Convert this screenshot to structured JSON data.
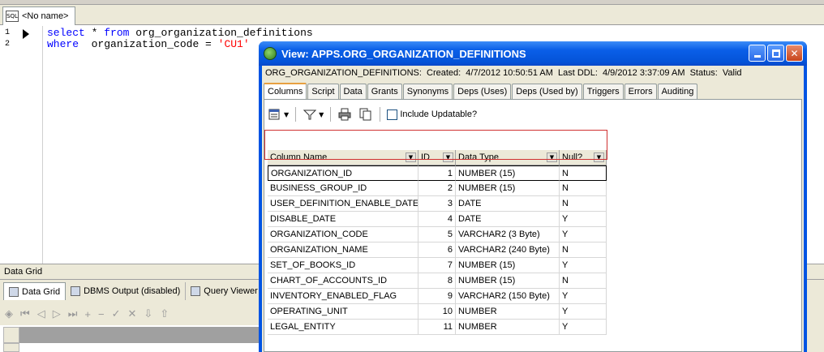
{
  "document_tab": {
    "label": "<No name>",
    "icon": "sql-file-icon"
  },
  "editor": {
    "line_numbers": [
      "1",
      "2"
    ],
    "line1": {
      "kw1": "select",
      "rest": " * ",
      "kw2": "from",
      "table": " org_organization_definitions"
    },
    "line2": {
      "kw": "where",
      "rest": "  organization_code = ",
      "str": "'CU1'"
    }
  },
  "bottom_panel": {
    "title": "Data Grid",
    "tabs": [
      {
        "label": "Data Grid",
        "icon": "grid-icon"
      },
      {
        "label": "DBMS Output (disabled)",
        "icon": "dbms-output-icon"
      },
      {
        "label": "Query Viewer",
        "icon": "query-viewer-icon"
      }
    ]
  },
  "window": {
    "title": "View:  APPS.ORG_ORGANIZATION_DEFINITIONS",
    "info": {
      "object": "ORG_ORGANIZATION_DEFINITIONS:",
      "created_label": "Created:",
      "created": "4/7/2012 10:50:51 AM",
      "ddl_label": "Last DDL:",
      "ddl": "4/9/2012 3:37:09 AM",
      "status_label": "Status:",
      "status": "Valid"
    },
    "tabs": [
      "Columns",
      "Script",
      "Data",
      "Grants",
      "Synonyms",
      "Deps (Uses)",
      "Deps (Used by)",
      "Triggers",
      "Errors",
      "Auditing"
    ],
    "toolbar": {
      "include_updatable": "Include Updatable?"
    },
    "grid": {
      "headers": [
        "Column Name",
        "ID",
        "Data Type",
        "Null?"
      ],
      "rows": [
        [
          "ORGANIZATION_ID",
          "1",
          "NUMBER (15)",
          "N"
        ],
        [
          "BUSINESS_GROUP_ID",
          "2",
          "NUMBER (15)",
          "N"
        ],
        [
          "USER_DEFINITION_ENABLE_DATE",
          "3",
          "DATE",
          "N"
        ],
        [
          "DISABLE_DATE",
          "4",
          "DATE",
          "Y"
        ],
        [
          "ORGANIZATION_CODE",
          "5",
          "VARCHAR2 (3 Byte)",
          "Y"
        ],
        [
          "ORGANIZATION_NAME",
          "6",
          "VARCHAR2 (240 Byte)",
          "N"
        ],
        [
          "SET_OF_BOOKS_ID",
          "7",
          "NUMBER (15)",
          "Y"
        ],
        [
          "CHART_OF_ACCOUNTS_ID",
          "8",
          "NUMBER (15)",
          "N"
        ],
        [
          "INVENTORY_ENABLED_FLAG",
          "9",
          "VARCHAR2 (150 Byte)",
          "Y"
        ],
        [
          "OPERATING_UNIT",
          "10",
          "NUMBER",
          "Y"
        ],
        [
          "LEGAL_ENTITY",
          "11",
          "NUMBER",
          "Y"
        ]
      ],
      "selected_row": 0
    }
  },
  "colors": {
    "title_bar": "#0054e3",
    "highlight": "#d03030",
    "keyword": "#0000ff",
    "string": "#ff0000"
  }
}
